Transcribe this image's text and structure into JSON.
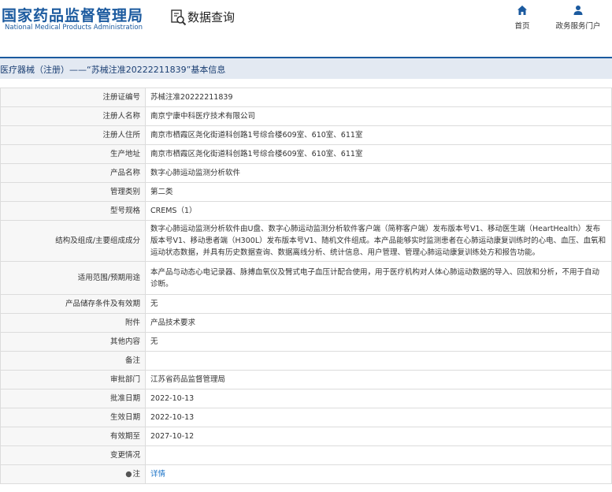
{
  "header": {
    "logo_cn": "国家药品监督管理局",
    "logo_en": "National Medical Products Administration",
    "section_title": "数据查询",
    "nav": [
      {
        "label": "首页",
        "icon": "home-icon"
      },
      {
        "label": "政务服务门户",
        "icon": "user-icon"
      }
    ]
  },
  "breadcrumb": "医疗器械（注册）——“苏械注准20222211839”基本信息",
  "fields": [
    {
      "key": "注册证编号",
      "value": "苏械注准20222211839"
    },
    {
      "key": "注册人名称",
      "value": "南京宁康中科医疗技术有限公司"
    },
    {
      "key": "注册人住所",
      "value": "南京市栖霞区尧化街道科创路1号综合楼609室、610室、611室"
    },
    {
      "key": "生产地址",
      "value": "南京市栖霞区尧化街道科创路1号综合楼609室、610室、611室"
    },
    {
      "key": "产品名称",
      "value": "数字心肺运动监测分析软件"
    },
    {
      "key": "管理类别",
      "value": "第二类"
    },
    {
      "key": "型号规格",
      "value": "CREMS（1）"
    },
    {
      "key": "结构及组成/主要组成成分",
      "value": "数字心肺运动监测分析软件由U盘、数字心肺运动监测分析软件客户端（简称客户端）发布版本号V1、移动医生端（HeartHealth）发布版本号V1、移动患者端（H300L）发布版本号V1、随机文件组成。本产品能够实时监测患者在心肺运动康复训练时的心电、血压、血氧和运动状态数据，并具有历史数据查询、数据离线分析、统计信息、用户管理、管理心肺运动康复训练处方和报告功能。"
    },
    {
      "key": "适用范围/预期用途",
      "value": "本产品与动态心电记录器、脉搏血氧仪及臂式电子血压计配合使用，用于医疗机构对人体心肺运动数据的导入、回放和分析，不用于自动诊断。"
    },
    {
      "key": "产品储存条件及有效期",
      "value": "无"
    },
    {
      "key": "附件",
      "value": "产品技术要求"
    },
    {
      "key": "其他内容",
      "value": "无"
    },
    {
      "key": "备注",
      "value": ""
    },
    {
      "key": "审批部门",
      "value": "江苏省药品监督管理局"
    },
    {
      "key": "批准日期",
      "value": "2022-10-13"
    },
    {
      "key": "生效日期",
      "value": "2022-10-13"
    },
    {
      "key": "有效期至",
      "value": "2027-10-12"
    },
    {
      "key": "变更情况",
      "value": ""
    }
  ],
  "note_row": {
    "key": "注",
    "pin": "●",
    "link": "详情"
  },
  "colors": {
    "brand": "#1b5a9f",
    "link": "#1b73c7",
    "breadcrumb_bg": "#e3e9f2"
  }
}
